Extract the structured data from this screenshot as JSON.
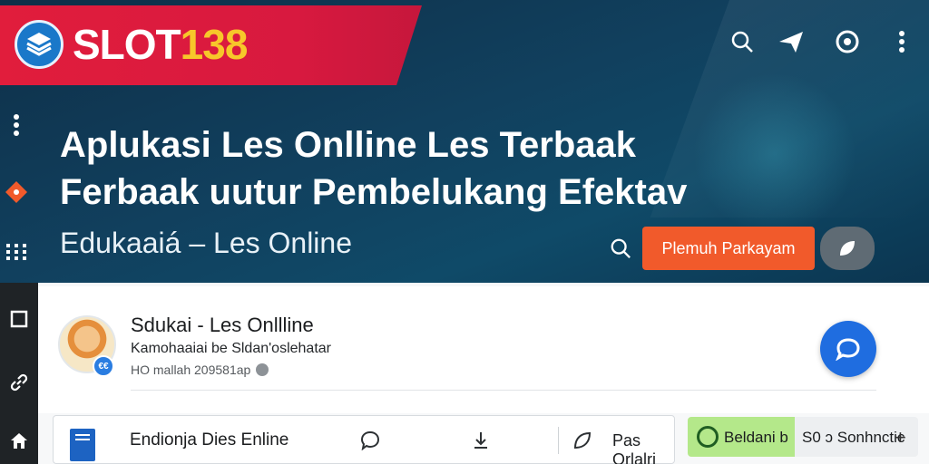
{
  "brand": {
    "logo_text": "SLOT",
    "logo_number": "138"
  },
  "hero": {
    "title": "Aplukasi Les Onlline Les Terbaak Ferbaak uutur Pembelukang Efektav",
    "subtitle": "Edukaaiá – Les Online",
    "cta_label": "Plemuh Parkayam"
  },
  "post": {
    "name": "Sdukai - Les Onllline",
    "meta_line": "Kamohaaiai be Sldan'oslehatar",
    "meta_time": "HO mallah 209581ap",
    "avatar_badge": "€€"
  },
  "bottom_bar": {
    "title": "Endionja Dies  Enline",
    "pass_label": "Pas Orlalri",
    "chip_green_label": "Beldani b",
    "chip_grey_label": "S0 ɔ Sonhnctic"
  },
  "colors": {
    "brand_red": "#e11d3c",
    "brand_yellow": "#f7c72a",
    "hero_bg": "#11405e",
    "cta_orange": "#f15a2b",
    "fab_blue": "#1f6de0",
    "chip_green": "#b4e88a"
  },
  "icons": [
    "search-icon",
    "send-icon",
    "settings-icon",
    "more-vert-icon",
    "chat-icon",
    "home-icon",
    "download-icon"
  ]
}
